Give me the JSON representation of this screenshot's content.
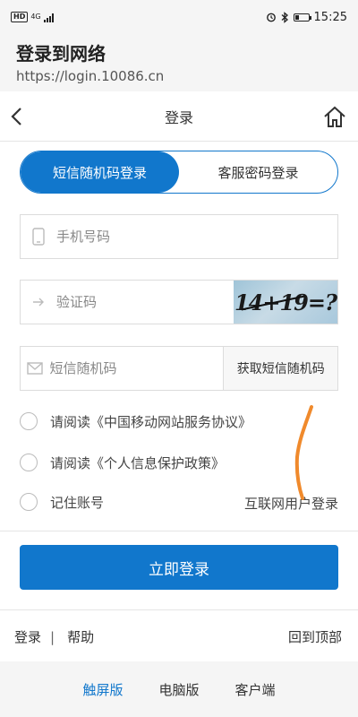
{
  "status_bar": {
    "hd": "HD",
    "signal": "4G",
    "time": "15:25",
    "icons": [
      "alarm-icon",
      "bluetooth-icon",
      "battery-icon"
    ]
  },
  "browser": {
    "title": "登录到网络",
    "url": "https://login.10086.cn"
  },
  "nav": {
    "title": "登录"
  },
  "tabs": [
    {
      "label": "短信随机码登录",
      "active": true
    },
    {
      "label": "客服密码登录",
      "active": false
    }
  ],
  "form": {
    "phone_placeholder": "手机号码",
    "captcha_placeholder": "验证码",
    "captcha_text": "14+19=?",
    "sms_placeholder": "短信随机码",
    "sms_button": "获取短信随机码"
  },
  "checks": [
    {
      "label": "请阅读《中国移动网站服务协议》"
    },
    {
      "label": "请阅读《个人信息保护政策》"
    },
    {
      "label": "记住账号"
    }
  ],
  "internet_login": "互联网用户登录",
  "submit": "立即登录",
  "footer": {
    "login": "登录",
    "separator": "|",
    "help": "帮助",
    "back_to_top": "回到顶部"
  },
  "bottom_tabs": [
    {
      "label": "触屏版",
      "active": true
    },
    {
      "label": "电脑版",
      "active": false
    },
    {
      "label": "客户端",
      "active": false
    }
  ],
  "colors": {
    "accent": "#1177cc",
    "scribble": "#f08a2c"
  }
}
